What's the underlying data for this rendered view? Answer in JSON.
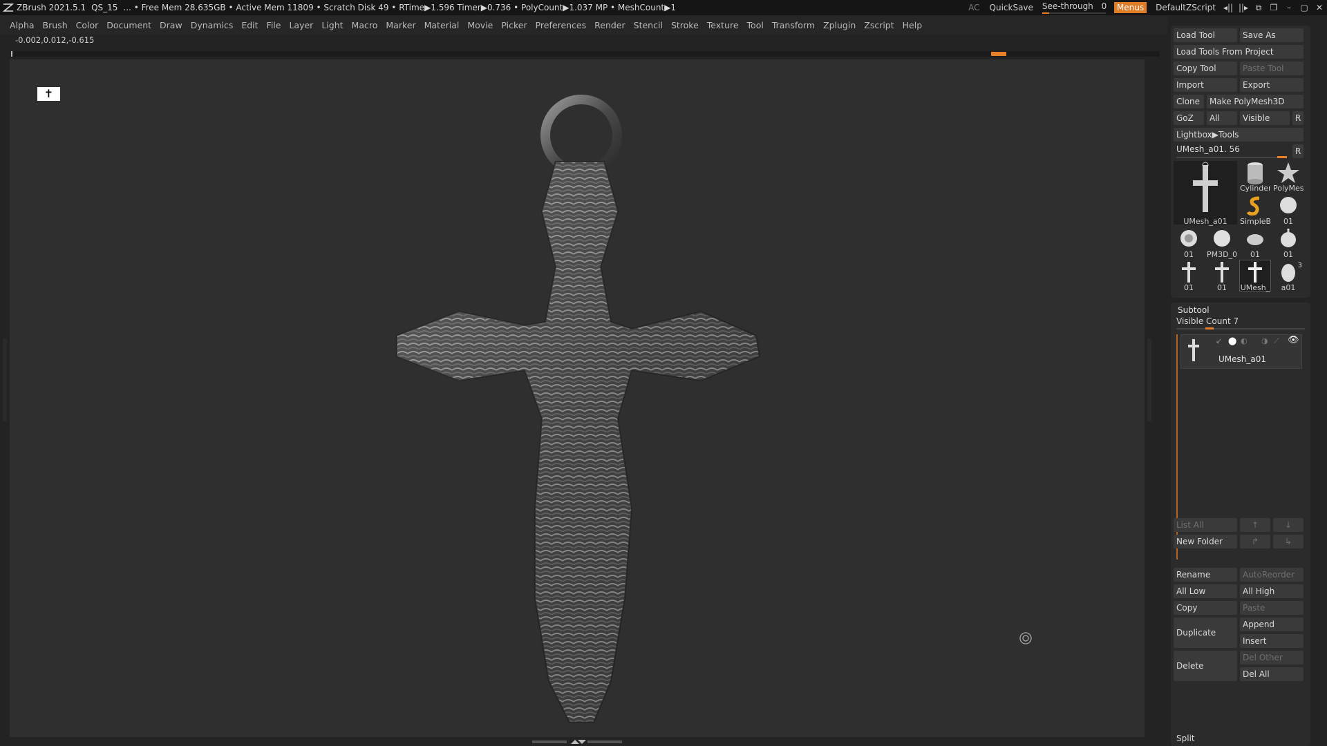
{
  "titlebar": {
    "app": "ZBrush 2021.5.1",
    "project": "QS_15",
    "stats": "... • Free Mem 28.635GB • Active Mem 11809 • Scratch Disk 49 •  RTime▶1.596 Timer▶0.736 • PolyCount▶1.037 MP  • MeshCount▶1",
    "ac": "AC",
    "quicksave": "QuickSave",
    "see_through_label": "See-through",
    "see_through_value": "0",
    "see_through_level": 0,
    "menus": "Menus",
    "default_zscript": "DefaultZScript"
  },
  "menubar": [
    "Alpha",
    "Brush",
    "Color",
    "Document",
    "Draw",
    "Dynamics",
    "Edit",
    "File",
    "Layer",
    "Light",
    "Macro",
    "Marker",
    "Material",
    "Movie",
    "Picker",
    "Preferences",
    "Render",
    "Stencil",
    "Stroke",
    "Texture",
    "Tool",
    "Transform",
    "Zplugin",
    "Zscript",
    "Help"
  ],
  "coords": "-0.002,0.012,-0.615",
  "tool": {
    "load_tool": "Load Tool",
    "save_as": "Save As",
    "load_from_project": "Load Tools From Project",
    "copy_tool": "Copy Tool",
    "paste_tool": "Paste Tool",
    "import": "Import",
    "export": "Export",
    "clone": "Clone",
    "make_polymesh": "Make PolyMesh3D",
    "goz": "GoZ",
    "all": "All",
    "visible": "Visible",
    "r": "R",
    "lightbox_tools": "Lightbox▶Tools",
    "mesh_slider_label": "UMesh_a01. 56",
    "mesh_slider_value": 56,
    "thumbs": {
      "main": "UMesh_a01",
      "cylinder": "Cylinder",
      "polymesh": "PolyMes",
      "simpleb": "SimpleB",
      "t01a": "01",
      "t01b": "01",
      "pm3d": "PM3D_0",
      "t01c": "01",
      "t01d": "01",
      "t01e": "01",
      "t01f": "01",
      "umesh": "UMesh_",
      "a01": "a01",
      "a01_count": "3"
    }
  },
  "subtool": {
    "title": "Subtool",
    "visible_count": "Visible Count 7",
    "item_name": "UMesh_a01",
    "list_all": "List All",
    "new_folder": "New Folder",
    "rename": "Rename",
    "autoreorder": "AutoReorder",
    "all_low": "All Low",
    "all_high": "All High",
    "copy": "Copy",
    "paste": "Paste",
    "duplicate": "Duplicate",
    "append": "Append",
    "insert": "Insert",
    "delete": "Delete",
    "del_other": "Del Other",
    "del_all": "Del All",
    "split": "Split"
  },
  "colors": {
    "accent": "#e8802a",
    "bg": "#232323",
    "viewport": "#2f2f2f"
  }
}
